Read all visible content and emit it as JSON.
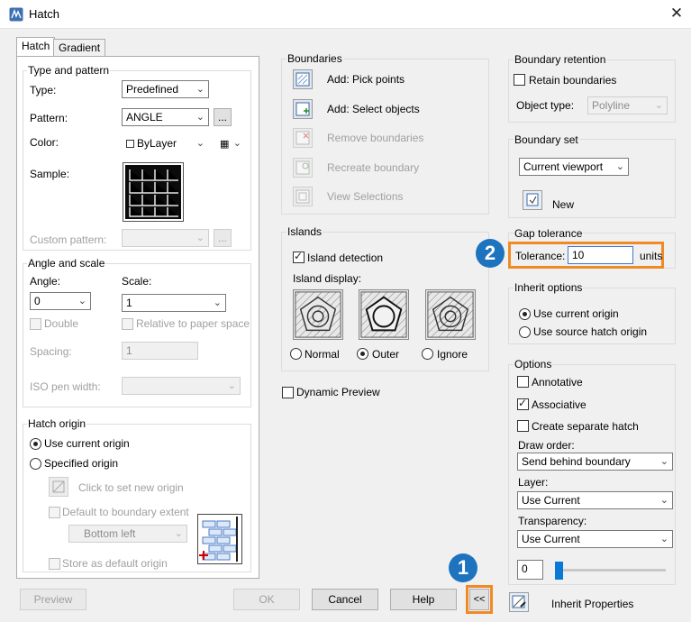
{
  "window": {
    "title": "Hatch",
    "close_glyph": "✕"
  },
  "tabs": [
    {
      "label": "Hatch"
    },
    {
      "label": "Gradient"
    }
  ],
  "type_pattern": {
    "group_label": "Type and pattern",
    "type_label": "Type:",
    "type_value": "Predefined",
    "pattern_label": "Pattern:",
    "pattern_value": "ANGLE",
    "pattern_browse": "...",
    "color_label": "Color:",
    "color_value": "ByLayer",
    "sample_label": "Sample:",
    "custom_label": "Custom pattern:",
    "custom_browse": "..."
  },
  "angle_scale": {
    "group_label": "Angle and scale",
    "angle_label": "Angle:",
    "angle_value": "0",
    "scale_label": "Scale:",
    "scale_value": "1",
    "double_label": "Double",
    "relative_label": "Relative to paper space",
    "spacing_label": "Spacing:",
    "spacing_value": "1",
    "iso_label": "ISO pen width:"
  },
  "hatch_origin": {
    "group_label": "Hatch origin",
    "use_current": "Use current origin",
    "specified": "Specified origin",
    "click_new": "Click to set new origin",
    "default_extent": "Default to boundary extent",
    "extent_value": "Bottom left",
    "store_default": "Store as default origin"
  },
  "boundaries": {
    "group_label": "Boundaries",
    "add_pick": "Add: Pick points",
    "add_select": "Add: Select objects",
    "remove": "Remove boundaries",
    "recreate": "Recreate boundary",
    "view": "View Selections"
  },
  "islands": {
    "group_label": "Islands",
    "detection": "Island detection",
    "display_label": "Island display:",
    "normal": "Normal",
    "outer": "Outer",
    "ignore": "Ignore"
  },
  "dynamic_preview": "Dynamic Preview",
  "boundary_retention": {
    "group_label": "Boundary retention",
    "retain": "Retain boundaries",
    "object_type_label": "Object type:",
    "object_type_value": "Polyline"
  },
  "boundary_set": {
    "group_label": "Boundary set",
    "value": "Current viewport",
    "new_label": "New"
  },
  "gap_tolerance": {
    "group_label": "Gap tolerance",
    "tolerance_label": "Tolerance:",
    "tolerance_value": "10",
    "units": "units"
  },
  "inherit_options": {
    "group_label": "Inherit options",
    "use_current": "Use current origin",
    "use_source": "Use source hatch origin"
  },
  "options": {
    "group_label": "Options",
    "annotative": "Annotative",
    "associative": "Associative",
    "separate": "Create separate hatch",
    "draw_order_label": "Draw order:",
    "draw_order_value": "Send behind boundary",
    "layer_label": "Layer:",
    "layer_value": "Use Current",
    "transparency_label": "Transparency:",
    "transparency_value": "Use Current",
    "transparency_amount": "0"
  },
  "footer": {
    "preview": "Preview",
    "ok": "OK",
    "cancel": "Cancel",
    "help": "Help",
    "collapse": "<<",
    "inherit": "Inherit Properties"
  },
  "callouts": {
    "one": "1",
    "two": "2"
  },
  "colors": {
    "highlight": "#f08a24",
    "badge": "#1e73be"
  }
}
